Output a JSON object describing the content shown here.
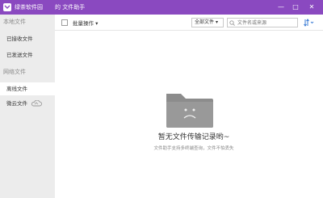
{
  "titlebar": {
    "app_name": "绿茶软件园",
    "tab_title": "的 文件助手",
    "minimize": "—",
    "maximize": "□",
    "close": "✕",
    "color": "#8a49c0"
  },
  "sidebar": {
    "local_section": "本地文件",
    "received": "已接收文件",
    "sent": "已发送文件",
    "network_section": "网络文件",
    "offline": "离线文件",
    "weiyun": "微云文件"
  },
  "toolbar": {
    "batch_label": "批量操作",
    "filter_value": "全部文件",
    "search_placeholder": "文件名或来源"
  },
  "empty": {
    "title": "暂无文件传输记录哟~",
    "subtitle": "文件助手支持多终端查询，文件不怕丢失"
  }
}
